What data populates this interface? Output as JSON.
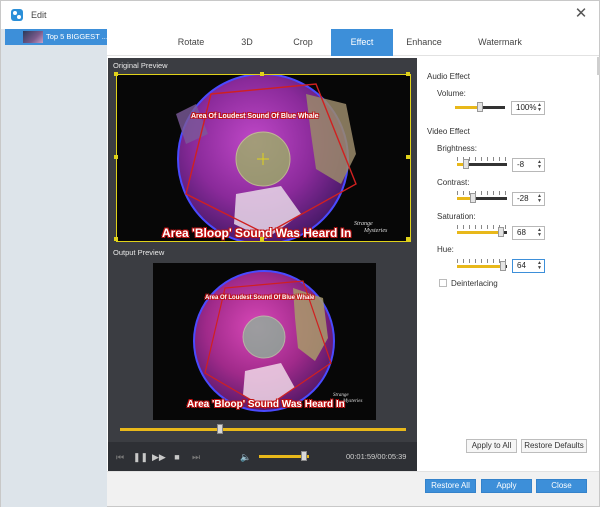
{
  "window": {
    "title": "Edit",
    "close_symbol": "✕",
    "accent": "#3d8fd9"
  },
  "filelist": {
    "items": [
      {
        "label": "Top 5 BIGGEST ..."
      }
    ]
  },
  "tabs": [
    {
      "label": "Rotate"
    },
    {
      "label": "3D"
    },
    {
      "label": "Crop"
    },
    {
      "label": "Effect"
    },
    {
      "label": "Enhance"
    },
    {
      "label": "Watermark"
    }
  ],
  "active_tab": "Effect",
  "preview": {
    "original_label": "Original Preview",
    "output_label": "Output Preview",
    "video_caption_top": "Area Of Loudest Sound Of Blue Whale",
    "video_caption_bottom": "Area 'Bloop' Sound Was Heard In",
    "video_watermark_line1": "Strange",
    "video_watermark_line2": "Mysteries"
  },
  "player": {
    "progress_fraction": 0.35,
    "volume_fraction": 0.9,
    "time": "00:01:59/00:05:39",
    "icons": [
      "skip-back-icon",
      "pause-icon",
      "fast-forward-icon",
      "stop-icon",
      "skip-end-icon",
      "volume-icon"
    ]
  },
  "audio_effect": {
    "heading": "Audio Effect",
    "volume": {
      "label": "Volume:",
      "value": "100%"
    }
  },
  "video_effect": {
    "heading": "Video Effect",
    "brightness": {
      "label": "Brightness:",
      "value": "-8"
    },
    "contrast": {
      "label": "Contrast:",
      "value": "-28"
    },
    "saturation": {
      "label": "Saturation:",
      "value": "68"
    },
    "hue": {
      "label": "Hue:",
      "value": "64"
    },
    "deinterlacing": {
      "label": "Deinterlacing",
      "checked": false
    }
  },
  "buttons": {
    "apply_to_all": "Apply to All",
    "restore_defaults": "Restore Defaults",
    "restore_all": "Restore All",
    "apply": "Apply",
    "close": "Close"
  }
}
